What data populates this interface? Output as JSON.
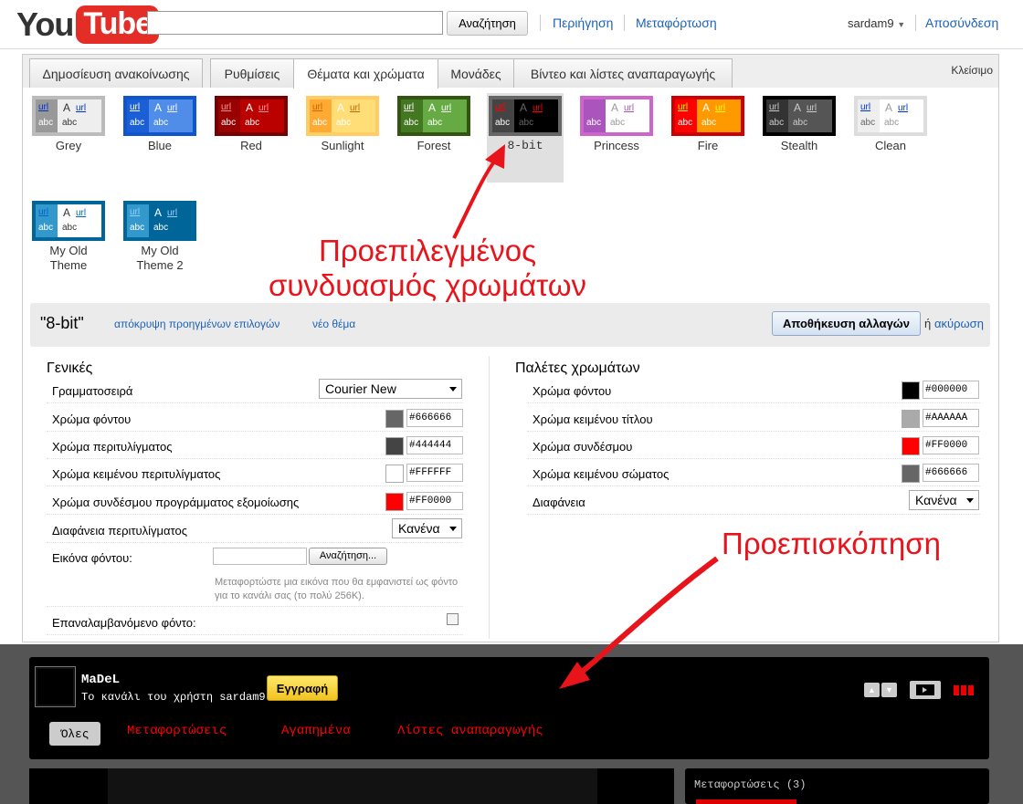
{
  "header": {
    "logo_you": "You",
    "logo_tube": "Tube",
    "search_value": "",
    "search_button": "Αναζήτηση",
    "browse": "Περιήγηση",
    "upload": "Μεταφόρτωση",
    "username": "sardam9",
    "signout": "Αποσύνδεση"
  },
  "tabs": [
    {
      "label": "Δημοσίευση ανακοίνωσης",
      "active": false
    },
    {
      "label": "Ρυθμίσεις",
      "active": false
    },
    {
      "label": "Θέματα και χρώματα",
      "active": true
    },
    {
      "label": "Μονάδες",
      "active": false
    },
    {
      "label": "Βίντεο και λίστες αναπαραγωγής",
      "active": false
    }
  ],
  "close_label": "Κλείσιμο",
  "themes": [
    {
      "name": "Grey",
      "border": "#bbbbbb",
      "left": "#999999",
      "right": "#eeeeee",
      "link": "#0033cc",
      "text": "#333333",
      "abc": "#ffffff"
    },
    {
      "name": "Blue",
      "border": "#1155cc",
      "left": "#1a5fd6",
      "right": "#4f8de8",
      "link": "#ffffff",
      "text": "#ffffff",
      "abc": "#ffffff"
    },
    {
      "name": "Red",
      "border": "#770000",
      "left": "#990000",
      "right": "#bb0000",
      "link": "#ff9999",
      "text": "#ffffff",
      "abc": "#ffffff"
    },
    {
      "name": "Sunlight",
      "border": "#ffcc66",
      "left": "#ffaa33",
      "right": "#ffdd77",
      "link": "#cc6600",
      "text": "#ffffff",
      "abc": "#ffffff"
    },
    {
      "name": "Forest",
      "border": "#335511",
      "left": "#447722",
      "right": "#66aa44",
      "link": "#ffffff",
      "text": "#ffffff",
      "abc": "#ffffff"
    },
    {
      "name": "8-bit",
      "border": "#666666",
      "left": "#444444",
      "right": "#000000",
      "link": "#ff0000",
      "text": "#666666",
      "abc": "#ffffff"
    },
    {
      "name": "Princess",
      "border": "#cc66cc",
      "left": "#aa55bb",
      "right": "#ffffff",
      "link": "#aa55bb",
      "text": "#999999",
      "abc": "#ffffff"
    },
    {
      "name": "Fire",
      "border": "#cc0000",
      "left": "#ff0000",
      "right": "#ff9900",
      "link": "#ffff00",
      "text": "#ffffff",
      "abc": "#ffffff"
    },
    {
      "name": "Stealth",
      "border": "#000000",
      "left": "#333333",
      "right": "#555555",
      "link": "#cccccc",
      "text": "#cccccc",
      "abc": "#cccccc"
    },
    {
      "name": "Clean",
      "border": "#dddddd",
      "left": "#eeeeee",
      "right": "#ffffff",
      "link": "#0033cc",
      "text": "#999999",
      "abc": "#666666"
    },
    {
      "name": "My Old Theme",
      "border": "#006699",
      "left": "#3399cc",
      "right": "#ffffff",
      "link": "#0066cc",
      "text": "#333333",
      "abc": "#ffffff"
    },
    {
      "name": "My Old Theme 2",
      "border": "#006699",
      "left": "#3399cc",
      "right": "#006699",
      "link": "#99ccff",
      "text": "#ffffff",
      "abc": "#ffffff"
    }
  ],
  "swatch_text": {
    "url": "url",
    "a": "A",
    "abc": "abc"
  },
  "theme_bar": {
    "name": "\"8-bit\"",
    "hide_advanced": "απόκρυψη προηγμένων επιλογών",
    "new_theme": "νέο θέμα",
    "save": "Αποθήκευση αλλαγών",
    "or": "ή",
    "cancel": "ακύρωση"
  },
  "general": {
    "title": "Γενικές",
    "font_label": "Γραμματοσειρά",
    "font_value": "Courier New",
    "bg_color_label": "Χρώμα φόντου",
    "bg_color": "#666666",
    "wrapper_color_label": "Χρώμα περιτυλίγματος",
    "wrapper_color": "#444444",
    "wrapper_text_label": "Χρώμα κειμένου περιτυλίγματος",
    "wrapper_text": "#FFFFFF",
    "player_link_label": "Χρώμα συνδέσμου προγράμματος εξομοίωσης",
    "player_link": "#FF0000",
    "wrapper_opacity_label": "Διαφάνεια περιτυλίγματος",
    "wrapper_opacity": "Κανένα",
    "bg_image_label": "Εικόνα φόντου:",
    "browse_button": "Αναζήτηση...",
    "bg_image_help": "Μεταφορτώστε μια εικόνα που θα εμφανιστεί ως φόντο για το κανάλι σας (το πολύ 256K).",
    "repeat_label": "Επαναλαμβανόμενο φόντο:"
  },
  "palettes": {
    "title": "Παλέτες χρωμάτων",
    "bg_label": "Χρώμα φόντου",
    "bg": "#000000",
    "title_text_label": "Χρώμα κειμένου τίτλου",
    "title_text": "#AAAAAA",
    "link_label": "Χρώμα συνδέσμου",
    "link": "#FF0000",
    "body_text_label": "Χρώμα κειμένου σώματος",
    "body_text": "#666666",
    "opacity_label": "Διαφάνεια",
    "opacity": "Κανένα"
  },
  "preview": {
    "channel_name": "MaDeL",
    "channel_sub": "Το κανάλι του χρήστη sardam9",
    "subscribe": "Εγγραφή",
    "tab_all": "Όλες",
    "tab_uploads": "Μεταφορτώσεις",
    "tab_favorites": "Αγαπημένα",
    "tab_playlists": "Λίστες αναπαραγωγής",
    "side_title": "Μεταφορτώσεις (3)"
  },
  "annotations": {
    "default_theme_line1": "Προεπιλεγμένος",
    "default_theme_line2": "συνδυασμός χρωμάτων",
    "preview": "Προεπισκόπηση"
  },
  "colors": {
    "link": "#1c62b9",
    "annotation": "#e8141b",
    "preview_link": "#ff0000"
  }
}
